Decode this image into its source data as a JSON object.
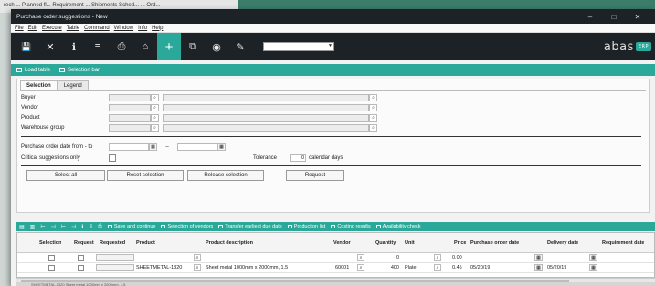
{
  "background": {
    "strip_text": "rech  ...  Planned fl... Requirement ... Shipments  Sched...  ...  Ord..."
  },
  "window": {
    "title": "Purchase order suggestions - New",
    "controls": [
      "–",
      "□",
      "✕"
    ]
  },
  "menu": [
    "File",
    "Edit",
    "Execute",
    "Table",
    "Command",
    "Window",
    "Info",
    "Help"
  ],
  "toolbar": {
    "buttons": [
      {
        "name": "save-icon",
        "glyph": "💾"
      },
      {
        "name": "close-icon",
        "glyph": "✕"
      },
      {
        "name": "info-icon",
        "glyph": "ℹ"
      },
      {
        "name": "list-icon",
        "glyph": "≡"
      },
      {
        "name": "print-icon",
        "glyph": "⎙"
      },
      {
        "name": "home-icon",
        "glyph": "⌂"
      },
      {
        "name": "new-plus-icon",
        "glyph": "+"
      },
      {
        "name": "copy-icon",
        "glyph": "⧉"
      },
      {
        "name": "view-eye-icon",
        "glyph": "◉"
      },
      {
        "name": "edit-pencil-icon",
        "glyph": "✎"
      }
    ],
    "select_value": "",
    "brand": "abas",
    "brand_badge": "ERP"
  },
  "actionbar": {
    "load_table": "Load table",
    "selection_bar": "Selection bar"
  },
  "tabs": [
    "Selection",
    "Legend"
  ],
  "form": {
    "buyer": "Buyer",
    "vendor": "Vendor",
    "product": "Product",
    "warehouse_group": "Warehouse group",
    "date_from_to": "Purchase order date from - to",
    "date_sep": "–",
    "critical_only": "Critical suggestions only",
    "tolerance_label": "Tolerance",
    "tolerance_value": "0",
    "tolerance_unit": "calendar days"
  },
  "buttons": {
    "select_all": "Select all",
    "reset_selection": "Reset selection",
    "release_selection": "Release selection",
    "request": "Request"
  },
  "gridbar": {
    "save_continue": "Save and continue",
    "selection_vendors": "Selection of vendors",
    "transfer_due": "Transfer earliest due date",
    "production_list": "Production list",
    "costing_results": "Costing results",
    "availability_check": "Availability check"
  },
  "grid": {
    "headers": {
      "selection": "Selection",
      "request": "Request",
      "requested": "Requested",
      "product": "Product",
      "product_description": "Product description",
      "vendor": "Vendor",
      "quantity": "Quantity",
      "unit": "Unit",
      "price": "Price",
      "po_date": "Purchase order date",
      "delivery_date": "Delivery date",
      "requirement_date": "Requirement date"
    },
    "rows": [
      {
        "product": "",
        "description": "",
        "vendor": "",
        "quantity": "0",
        "unit": "",
        "price": "0.00",
        "po_date": "",
        "delivery_date": "",
        "requirement_date": ""
      },
      {
        "product": "SHEETMETAL-1320",
        "description": "Sheet metal 1000mm x 2000mm, 1.5",
        "vendor": "60001",
        "quantity": "400",
        "unit": "Plate",
        "price": "0.45",
        "po_date": "05/20/19",
        "delivery_date": "05/20/19",
        "requirement_date": ""
      }
    ]
  },
  "status": {
    "text": "SHEETMETAL-1320  Sheet metal 1000mm x 2000mm, 1.5"
  }
}
